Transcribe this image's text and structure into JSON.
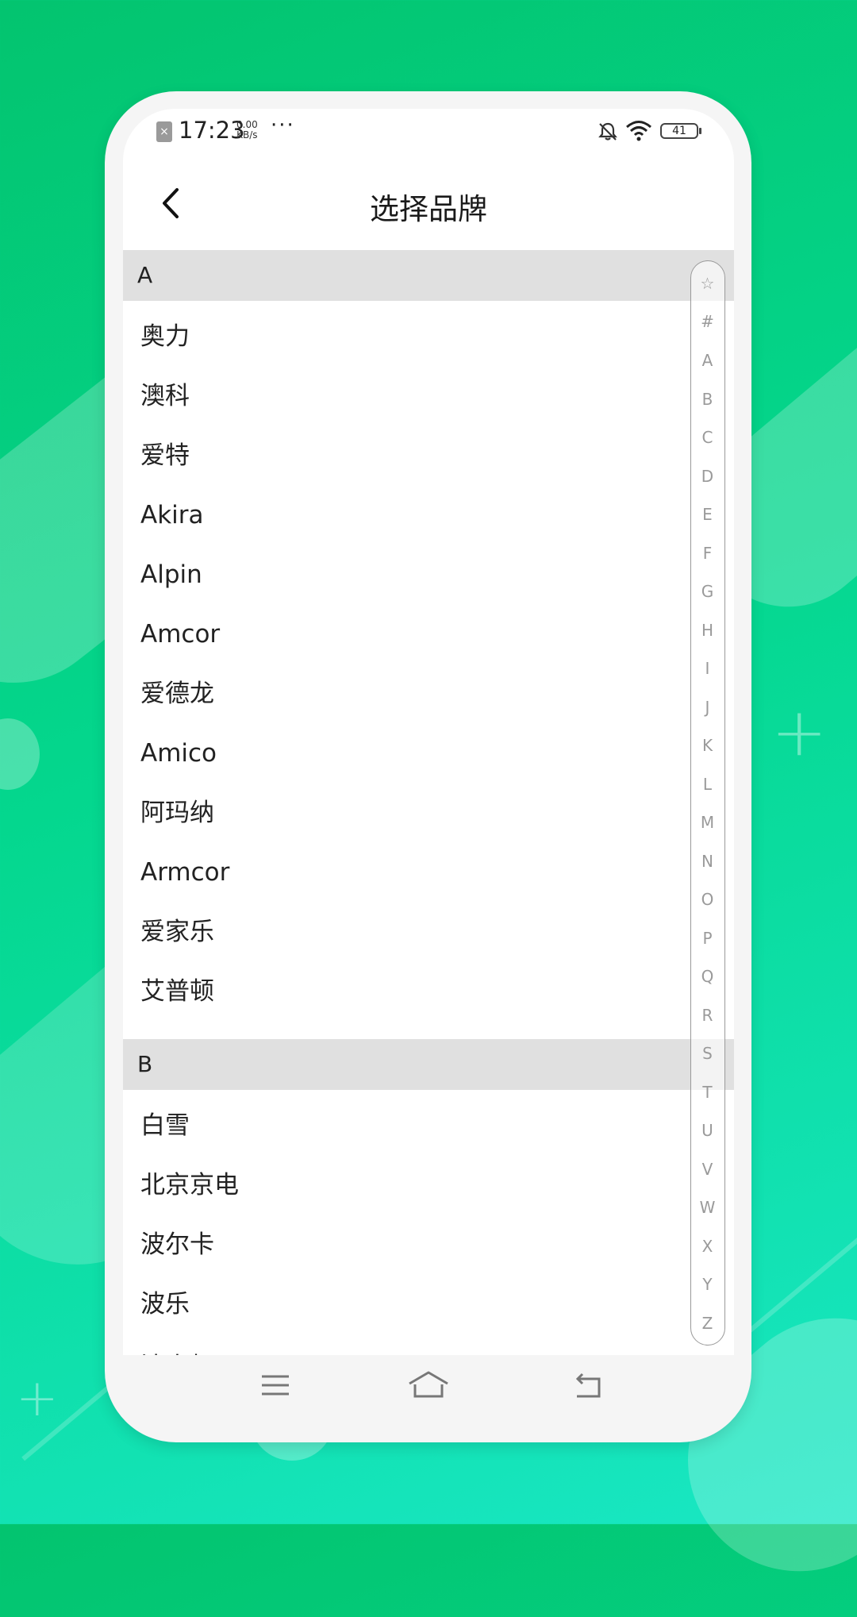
{
  "status_bar": {
    "time": "17:23",
    "net_speed_value": "0.00",
    "net_speed_unit": "KB/s",
    "more": "···",
    "battery": "41"
  },
  "header": {
    "title": "选择品牌"
  },
  "sections": [
    {
      "letter": "A",
      "items": [
        "奥力",
        "澳科",
        "爱特",
        "Akira",
        "Alpin",
        "Amcor",
        "爱德龙",
        "Amico",
        "阿玛纳",
        "Armcor",
        "爱家乐",
        "艾普顿"
      ]
    },
    {
      "letter": "B",
      "items": [
        "白雪",
        "北京京电",
        "波尔卡",
        "波乐"
      ]
    }
  ],
  "index_letters": [
    "☆",
    "#",
    "A",
    "B",
    "C",
    "D",
    "E",
    "F",
    "G",
    "H",
    "I",
    "J",
    "K",
    "L",
    "M",
    "N",
    "O",
    "P",
    "Q",
    "R",
    "S",
    "T",
    "U",
    "V",
    "W",
    "X",
    "Y",
    "Z"
  ],
  "icons": {
    "back": "chevron-left-icon",
    "menu": "menu-icon",
    "home": "home-icon",
    "return": "return-icon"
  }
}
